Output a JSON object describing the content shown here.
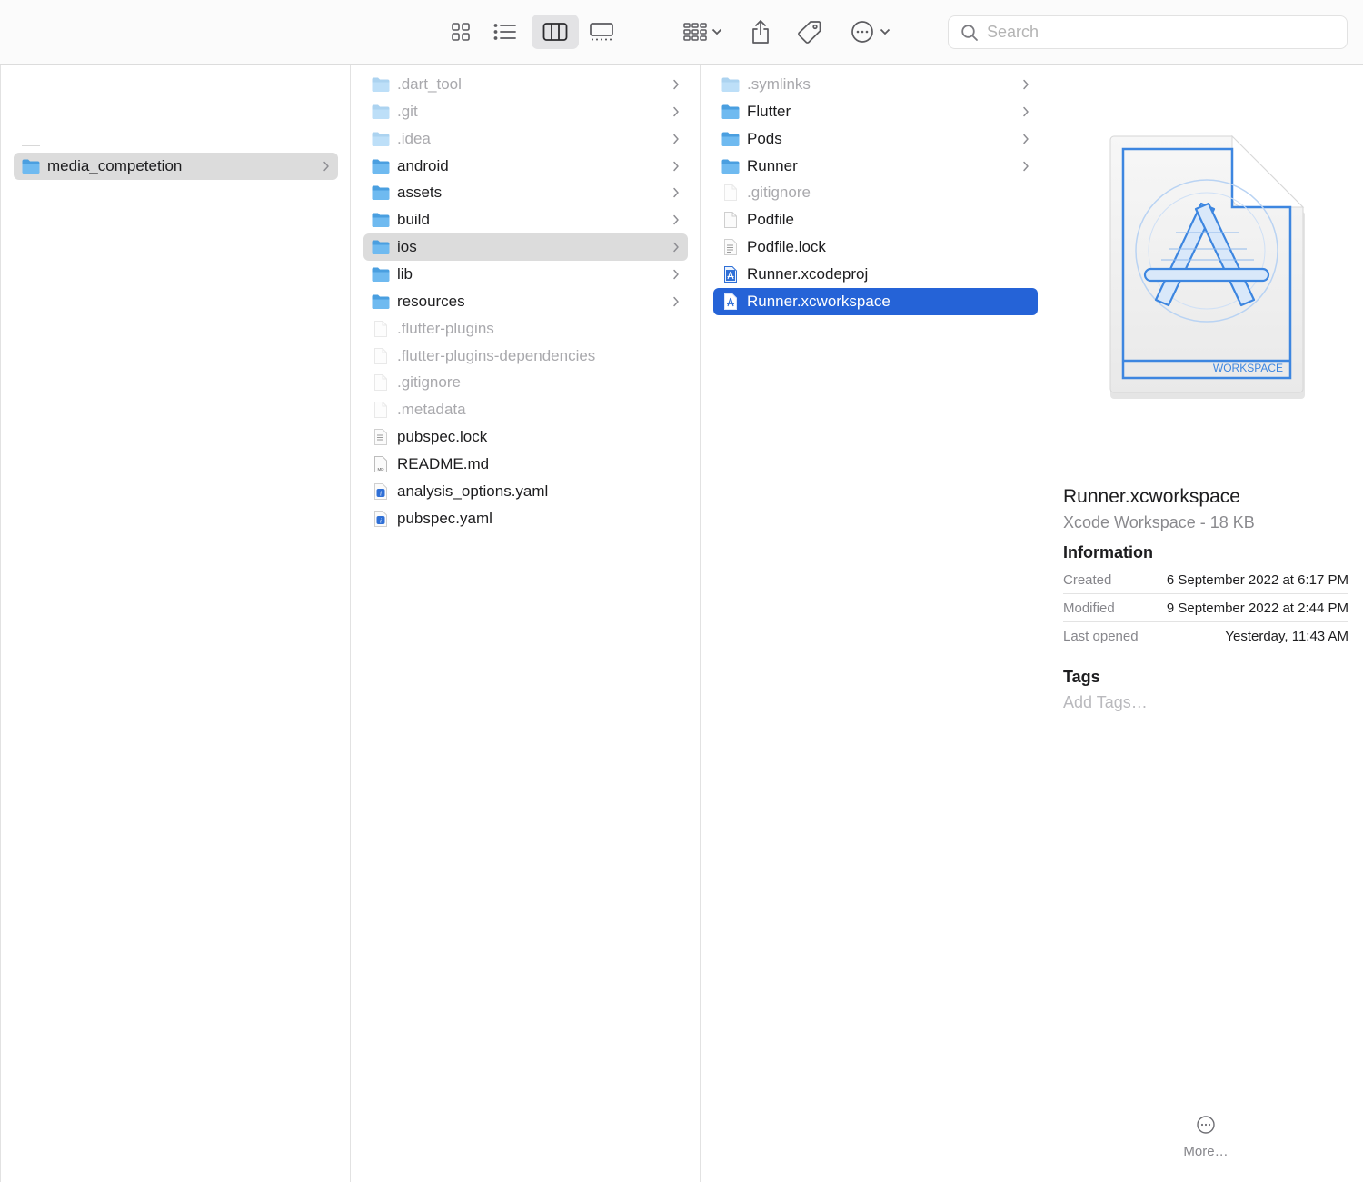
{
  "toolbar": {
    "view_buttons": [
      {
        "name": "icon-view-icon",
        "active": false
      },
      {
        "name": "list-view-icon",
        "active": false
      },
      {
        "name": "column-view-icon",
        "active": true
      },
      {
        "name": "gallery-view-icon",
        "active": false
      }
    ],
    "search_placeholder": "Search"
  },
  "columns": {
    "col1": [
      {
        "label": "media_competetion",
        "type": "folder",
        "hidden": false,
        "has_chevron": true,
        "selection": "grey"
      }
    ],
    "col2": [
      {
        "label": ".dart_tool",
        "type": "folder",
        "hidden": true,
        "has_chevron": true
      },
      {
        "label": ".git",
        "type": "folder",
        "hidden": true,
        "has_chevron": true
      },
      {
        "label": ".idea",
        "type": "folder",
        "hidden": true,
        "has_chevron": true
      },
      {
        "label": "android",
        "type": "folder",
        "hidden": false,
        "has_chevron": true
      },
      {
        "label": "assets",
        "type": "folder",
        "hidden": false,
        "has_chevron": true
      },
      {
        "label": "build",
        "type": "folder",
        "hidden": false,
        "has_chevron": true
      },
      {
        "label": "ios",
        "type": "folder",
        "hidden": false,
        "has_chevron": true,
        "selection": "grey"
      },
      {
        "label": "lib",
        "type": "folder",
        "hidden": false,
        "has_chevron": true
      },
      {
        "label": "resources",
        "type": "folder",
        "hidden": false,
        "has_chevron": true
      },
      {
        "label": ".flutter-plugins",
        "type": "file",
        "hidden": true,
        "has_chevron": false
      },
      {
        "label": ".flutter-plugins-dependencies",
        "type": "file",
        "hidden": true,
        "has_chevron": false
      },
      {
        "label": ".gitignore",
        "type": "file",
        "hidden": true,
        "has_chevron": false
      },
      {
        "label": ".metadata",
        "type": "file",
        "hidden": true,
        "has_chevron": false
      },
      {
        "label": "pubspec.lock",
        "type": "text",
        "hidden": false,
        "has_chevron": false
      },
      {
        "label": "README.md",
        "type": "md",
        "hidden": false,
        "has_chevron": false
      },
      {
        "label": "analysis_options.yaml",
        "type": "yaml",
        "hidden": false,
        "has_chevron": false
      },
      {
        "label": "pubspec.yaml",
        "type": "yaml",
        "hidden": false,
        "has_chevron": false
      }
    ],
    "col3": [
      {
        "label": ".symlinks",
        "type": "folder",
        "hidden": true,
        "has_chevron": true
      },
      {
        "label": "Flutter",
        "type": "folder",
        "hidden": false,
        "has_chevron": true
      },
      {
        "label": "Pods",
        "type": "folder",
        "hidden": false,
        "has_chevron": true
      },
      {
        "label": "Runner",
        "type": "folder",
        "hidden": false,
        "has_chevron": true
      },
      {
        "label": ".gitignore",
        "type": "file",
        "hidden": true,
        "has_chevron": false
      },
      {
        "label": "Podfile",
        "type": "file",
        "hidden": false,
        "has_chevron": false
      },
      {
        "label": "Podfile.lock",
        "type": "text",
        "hidden": false,
        "has_chevron": false
      },
      {
        "label": "Runner.xcodeproj",
        "type": "xcode",
        "hidden": false,
        "has_chevron": false
      },
      {
        "label": "Runner.xcworkspace",
        "type": "xcworkspace",
        "hidden": false,
        "has_chevron": false,
        "selection": "blue"
      }
    ]
  },
  "preview": {
    "icon_badge": "WORKSPACE",
    "file_name": "Runner.xcworkspace",
    "kind": "Xcode Workspace - 18 KB",
    "information_heading": "Information",
    "info": [
      {
        "key": "Created",
        "value": "6 September 2022 at 6:17 PM"
      },
      {
        "key": "Modified",
        "value": "9 September 2022 at 2:44 PM"
      },
      {
        "key": "Last opened",
        "value": "Yesterday, 11:43 AM"
      }
    ],
    "tags_heading": "Tags",
    "tags_placeholder": "Add Tags…",
    "more_label": "More…"
  },
  "colors": {
    "selection_blue": "#2563d7",
    "selection_grey": "#dcdcdc",
    "folder_blue": "#5fb0e8",
    "hidden_text": "#a9a9ad"
  }
}
